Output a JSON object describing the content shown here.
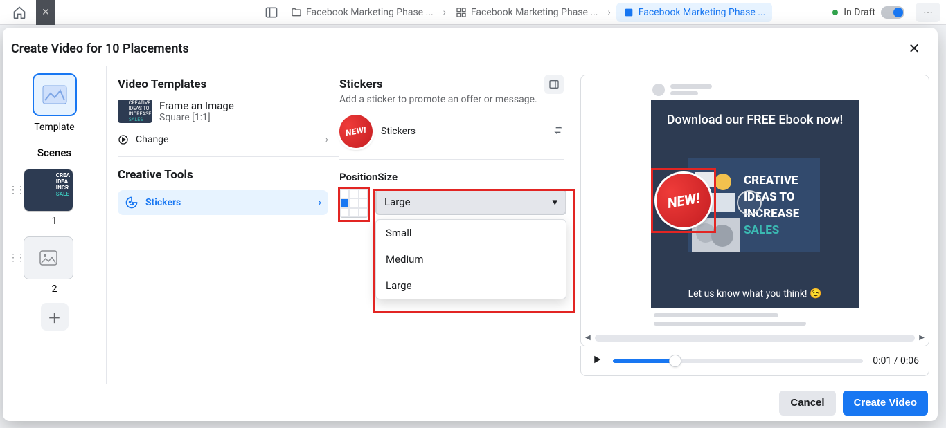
{
  "bg": {
    "status": "In Draft",
    "crumbs": [
      {
        "label": "Facebook Marketing Phase ..."
      },
      {
        "label": "Facebook Marketing Phase ..."
      },
      {
        "label": "Facebook Marketing Phase ..."
      }
    ],
    "tab_title": "Facebook Marketing Phas..."
  },
  "modal": {
    "title": "Create Video for 10 Placements",
    "close": "✕"
  },
  "rail": {
    "template_label": "Template",
    "scenes_label": "Scenes",
    "scene_numbers": [
      "1",
      "2"
    ]
  },
  "templates": {
    "heading": "Video Templates",
    "name": "Frame an Image",
    "subtitle": "Square [1:1]",
    "change_label": "Change",
    "thumb_lines": [
      "CREATIVE",
      "IDEAS TO",
      "INCREASE",
      "SALES"
    ]
  },
  "creative": {
    "heading": "Creative Tools",
    "stickers_item": "Stickers"
  },
  "stickers": {
    "heading": "Stickers",
    "sub": "Add a sticker to promote an offer or message.",
    "row_label": "Stickers",
    "badge_text": "NEW!",
    "possize_label": "PositionSize",
    "selected_size": "Large",
    "options": [
      "Small",
      "Medium",
      "Large"
    ],
    "position_index": 3
  },
  "preview": {
    "top_text": "Download our FREE Ebook now!",
    "card_lines": [
      "CREATIVE",
      "IDEAS TO",
      "INCREASE",
      "SALES"
    ],
    "bottom_text": "Let us know what you think! 😉",
    "time": "0:01 / 0:06"
  },
  "footer": {
    "cancel": "Cancel",
    "create": "Create Video"
  },
  "colors": {
    "accent": "#1877f2",
    "highlight_border": "#e22523",
    "hero_bg": "#2d3b52",
    "teal": "#3bb9b2"
  }
}
